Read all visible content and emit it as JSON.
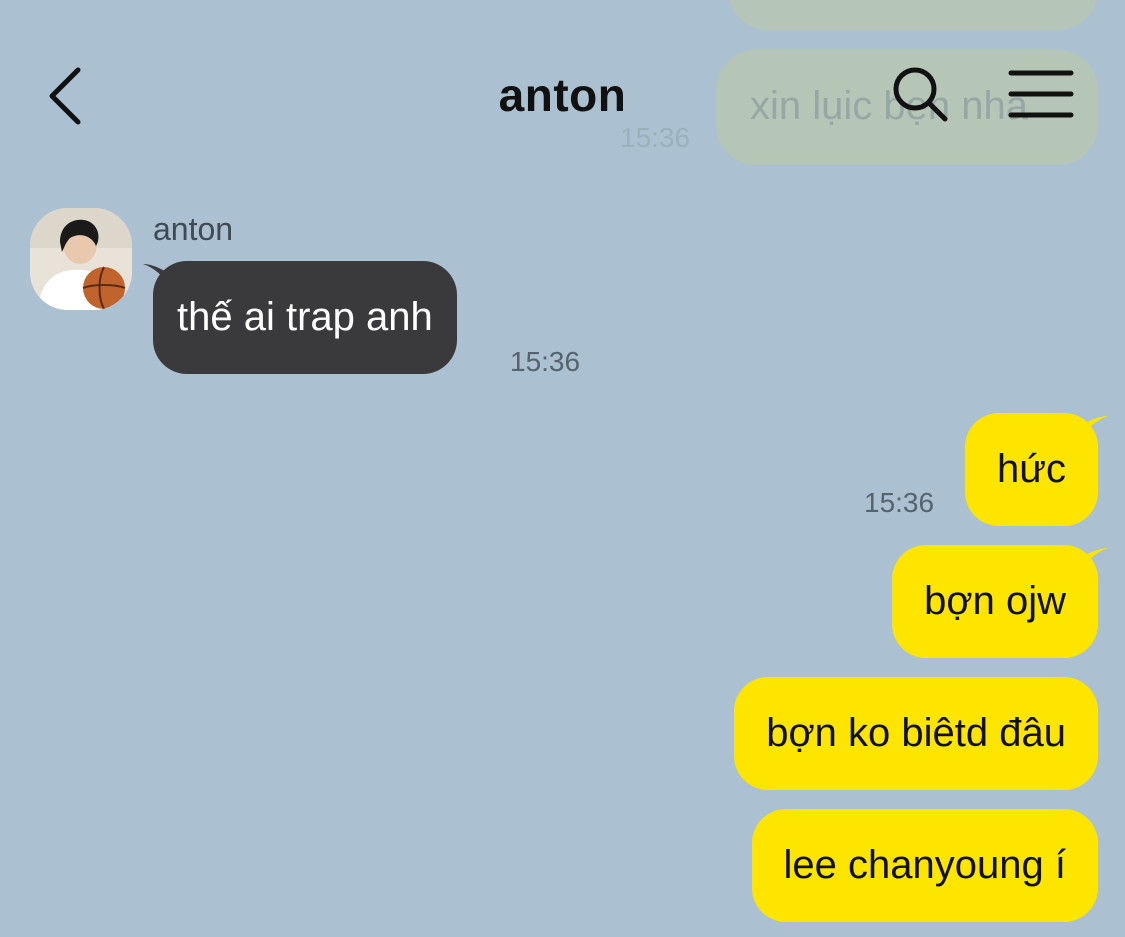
{
  "header": {
    "title": "anton"
  },
  "background_messages": {
    "faded_text": "xin lụic bẹn nha",
    "faded_time": "15:36"
  },
  "incoming": {
    "sender": "anton",
    "text": "thế ai trap anh",
    "time": "15:36"
  },
  "outgoing": [
    {
      "text": "hức",
      "time": "15:36"
    },
    {
      "text": "bợn ojw"
    },
    {
      "text": "bợn ko biêtd đâu"
    },
    {
      "text": "lee chanyoung í"
    }
  ],
  "colors": {
    "background": "#abc1d1",
    "outgoing_bubble": "#fee500",
    "incoming_bubble": "#3a3a3c"
  }
}
